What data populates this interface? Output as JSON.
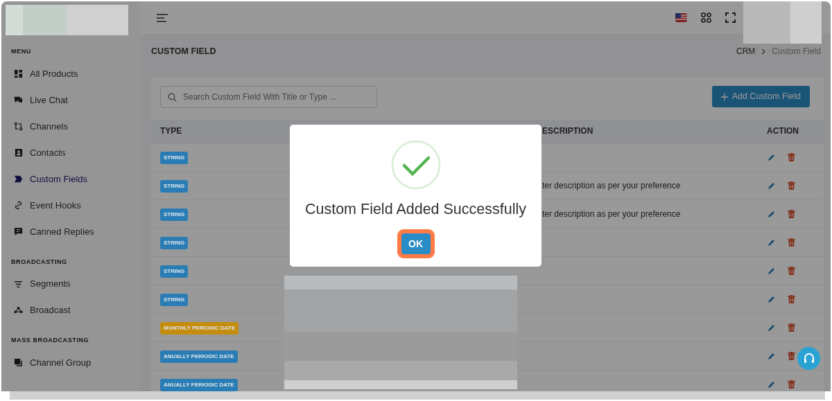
{
  "sidebar": {
    "sections": [
      {
        "heading": "MENU",
        "items": [
          {
            "label": "All Products",
            "selected": false
          },
          {
            "label": "Live Chat",
            "selected": false
          },
          {
            "label": "Channels",
            "selected": false
          },
          {
            "label": "Contacts",
            "selected": false
          },
          {
            "label": "Custom Fields",
            "selected": true
          },
          {
            "label": "Event Hooks",
            "selected": false
          },
          {
            "label": "Canned Replies",
            "selected": false
          }
        ]
      },
      {
        "heading": "BROADCASTING",
        "items": [
          {
            "label": "Segments",
            "selected": false
          },
          {
            "label": "Broadcast",
            "selected": false
          }
        ]
      },
      {
        "heading": "MASS BROADCASTING",
        "items": [
          {
            "label": "Channel Group",
            "selected": false
          }
        ]
      }
    ]
  },
  "page_title": "CUSTOM FIELD",
  "breadcrumb": [
    {
      "label": "CRM",
      "active": false
    },
    {
      "label": "Custom Field",
      "active": true
    }
  ],
  "search": {
    "placeholder": "Search Custom Field With Title or Type ..."
  },
  "add_button": {
    "label": "Add Custom Field"
  },
  "table": {
    "columns": {
      "type": "TYPE",
      "description": "ESCRIPTION",
      "action": "ACTION"
    },
    "rows": [
      {
        "type": "STRING",
        "color": "#2a7db4"
      },
      {
        "type": "STRING",
        "color": "#2a7db4",
        "description": "ter description as per your preference"
      },
      {
        "type": "STRING",
        "color": "#2a7db4",
        "description": "ter description as per your preference"
      },
      {
        "type": "STRING",
        "color": "#2a7db4"
      },
      {
        "type": "STRING",
        "color": "#2a7db4"
      },
      {
        "type": "STRING",
        "color": "#2a7db4"
      },
      {
        "type": "MONTHLY PERIODIC DATE",
        "color": "#c48d10"
      },
      {
        "type": "ANUALLY PERIODIC DATE",
        "color": "#2a7db4"
      },
      {
        "type": "ANUALLY PERIODIC DATE",
        "color": "#2a7db4"
      }
    ]
  },
  "modal": {
    "message": "Custom Field Added Successfully",
    "button": "OK",
    "highlighted": true
  }
}
